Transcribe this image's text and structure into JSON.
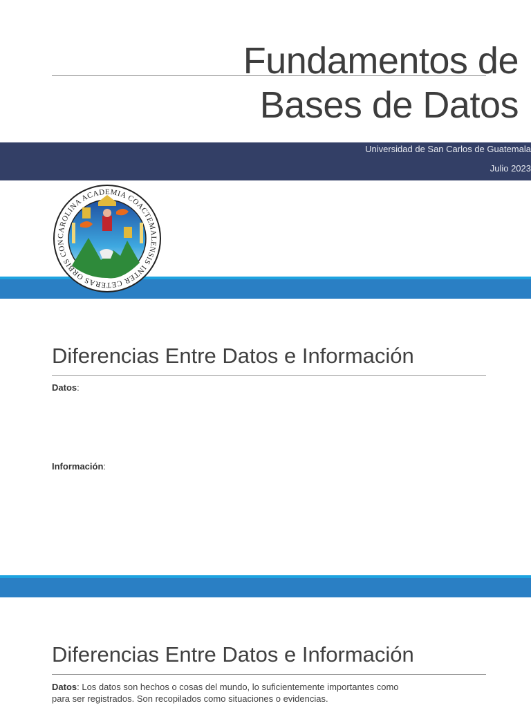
{
  "slide1": {
    "title_line1": "Fundamentos de",
    "title_line2": "Bases de Datos",
    "institution": "Universidad de San Carlos de Guatemala",
    "date": "Julio 2023",
    "seal_text": "CAROLINA ACADEMIA COACTEMALENSIS INTER CETERAS ORBIS CONSPICUA"
  },
  "slide2": {
    "heading": "Diferencias Entre Datos e Información",
    "datos_label": "Datos",
    "info_label": "Información",
    "colon": ":"
  },
  "slide3": {
    "heading": "Diferencias Entre Datos e Información",
    "datos_label": "Datos",
    "datos_text": ": Los datos son hechos o cosas del mundo, lo suficientemente importantes como para ser registrados. Son recopilados como situaciones o evidencias."
  },
  "colors": {
    "dark_band": "#333f66",
    "blue_band": "#2a7fc4",
    "light_band": "#1ea3e0"
  }
}
